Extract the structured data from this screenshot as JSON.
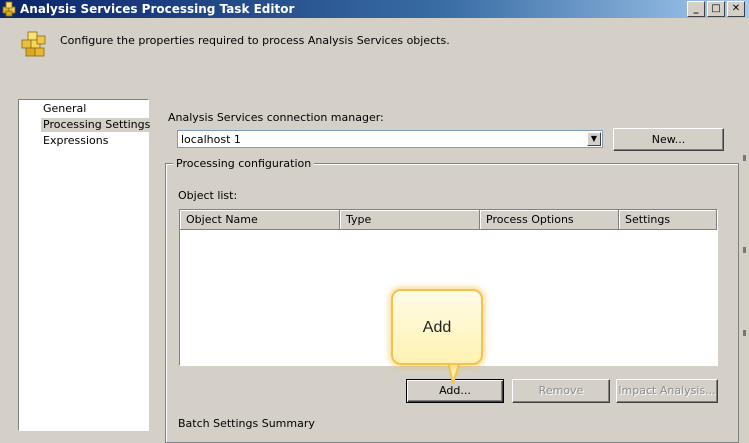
{
  "window": {
    "title": "Analysis Services Processing Task Editor",
    "minimize_glyph": "_",
    "maximize_glyph": "□",
    "close_glyph": "✕"
  },
  "header": {
    "description": "Configure the properties required to process Analysis Services objects.",
    "icon": "cube-icon"
  },
  "nav": {
    "items": [
      {
        "label": "General"
      },
      {
        "label": "Processing Settings",
        "selected": true
      },
      {
        "label": "Expressions"
      }
    ]
  },
  "connection": {
    "label": "Analysis Services connection manager:",
    "value": "localhost 1",
    "new_button": "New..."
  },
  "processing": {
    "group_title": "Processing configuration",
    "object_list_label": "Object list:",
    "columns": [
      "Object Name",
      "Type",
      "Process Options",
      "Settings"
    ],
    "rows": [],
    "add_button": "Add...",
    "remove_button": "Remove",
    "impact_button": "Impact Analysis..."
  },
  "callout": {
    "text": "Add"
  },
  "bottom": {
    "partial_label": "Batch Settings Summary"
  },
  "colors": {
    "titlebar_start": "#0a246a",
    "titlebar_end": "#a6caf0",
    "dialog_bg": "#d4d0c8",
    "callout_border": "#f4c24d"
  }
}
